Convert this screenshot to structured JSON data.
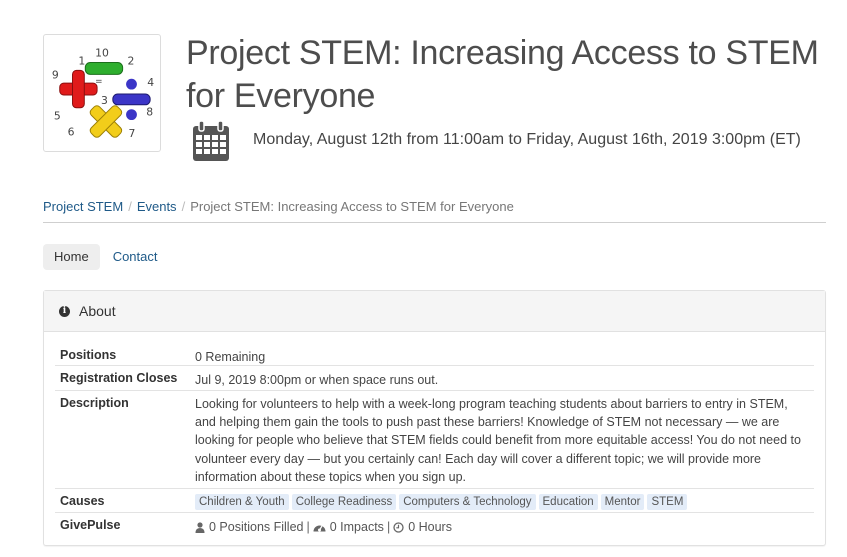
{
  "header": {
    "logo_alt": "math symbols logo",
    "title": "Project STEM: Increasing Access to STEM for Everyone",
    "date_icon": "calendar-icon",
    "date_text": "Monday, August 12th from 11:00am to Friday, August 16th, 2019 3:00pm (ET)"
  },
  "breadcrumb": [
    {
      "label": "Project STEM"
    },
    {
      "label": "Events"
    },
    {
      "label": "Project STEM: Increasing Access to STEM for Everyone"
    }
  ],
  "nav": {
    "tabs": [
      {
        "label": "Home",
        "active": true
      },
      {
        "label": "Contact",
        "active": false
      }
    ]
  },
  "about": {
    "heading": "About",
    "heading_icon": "info-circle-icon",
    "rows": [
      {
        "label": "Positions",
        "value": "0 Remaining"
      },
      {
        "label": "Registration Closes",
        "value": "Jul 9, 2019 8:00pm or when space runs out."
      },
      {
        "label": "Description",
        "value": "Looking for volunteers to help with a week-long program teaching students about barriers to entry in STEM, and helping them gain the tools to push past these barriers! Knowledge of STEM not necessary — we are looking for people who believe that STEM fields could benefit from more equitable access! You do not need to volunteer every day — but you certainly can! Each day will cover a different topic; we will provide more information about these topics when you sign up."
      },
      {
        "label": "Causes",
        "tags": [
          "Children & Youth",
          "College Readiness",
          "Computers & Technology",
          "Education",
          "Mentor",
          "STEM"
        ]
      },
      {
        "label": "GivePulse",
        "stats": [
          {
            "icon": "user-icon",
            "text": "0 Positions Filled"
          },
          {
            "icon": "dashboard-icon",
            "text": "0 Impacts"
          },
          {
            "icon": "clock-icon",
            "text": "0 Hours"
          }
        ]
      }
    ]
  },
  "colors": {
    "link": "#1f5a88",
    "tag_bg": "#e3ecf8",
    "panel_head_bg": "#f5f5f5"
  }
}
